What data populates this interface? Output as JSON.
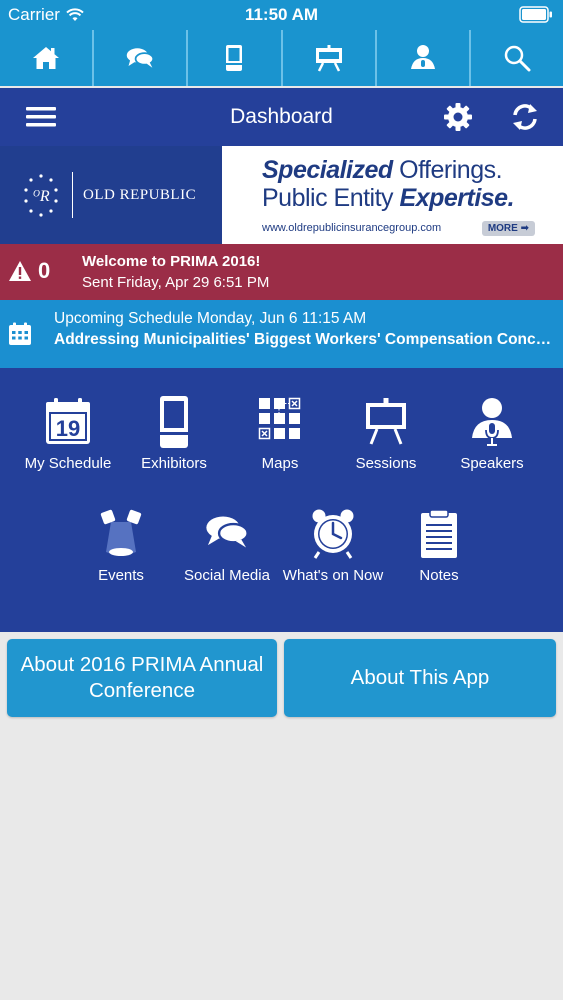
{
  "status_bar": {
    "carrier": "Carrier",
    "time": "11:50 AM"
  },
  "top_nav": {
    "items": [
      {
        "name": "home",
        "icon": "home-icon"
      },
      {
        "name": "messages",
        "icon": "chat-bubbles-icon"
      },
      {
        "name": "exhibitors",
        "icon": "booth-icon"
      },
      {
        "name": "sessions",
        "icon": "easel-icon"
      },
      {
        "name": "speakers",
        "icon": "speaker-icon"
      },
      {
        "name": "search",
        "icon": "search-icon"
      }
    ]
  },
  "title_bar": {
    "title": "Dashboard"
  },
  "banner": {
    "logo_name": "OLD REPUBLIC",
    "ad_line1_bold": "Specialized",
    "ad_line1_rest": " Offerings.",
    "ad_line2_start": "Public Entity ",
    "ad_line2_bold": "Expertise.",
    "ad_url": "www.oldrepublicinsurancegroup.com",
    "ad_more": "MORE ➡"
  },
  "alert": {
    "count": "0",
    "title": "Welcome to PRIMA 2016!",
    "sent": "Sent Friday, Apr 29 6:51 PM"
  },
  "schedule": {
    "line1": "Upcoming Schedule Monday, Jun 6 11:15 AM",
    "line2": "Addressing Municipalities' Biggest Workers' Compensation Concerns"
  },
  "dashboard": {
    "calendar_day": "19",
    "tiles": [
      {
        "label": "My Schedule",
        "icon": "calendar-icon"
      },
      {
        "label": "Exhibitors",
        "icon": "booth-icon"
      },
      {
        "label": "Maps",
        "icon": "map-grid-icon"
      },
      {
        "label": "Sessions",
        "icon": "easel-icon"
      },
      {
        "label": "Speakers",
        "icon": "speaker-icon"
      },
      {
        "label": "Events",
        "icon": "spotlights-icon"
      },
      {
        "label": "Social Media",
        "icon": "chat-bubbles-icon"
      },
      {
        "label": "What's on Now",
        "icon": "alarm-clock-icon"
      },
      {
        "label": "Notes",
        "icon": "notepad-icon"
      }
    ]
  },
  "about": {
    "conference": "About 2016 PRIMA Annual Conference",
    "app": "About This App"
  },
  "colors": {
    "nav_blue": "#1a94cf",
    "dashboard_blue": "#24409a",
    "alert_red": "#9b2d47",
    "schedule_blue": "#1b8fd0",
    "background": "#e9e9e9"
  }
}
